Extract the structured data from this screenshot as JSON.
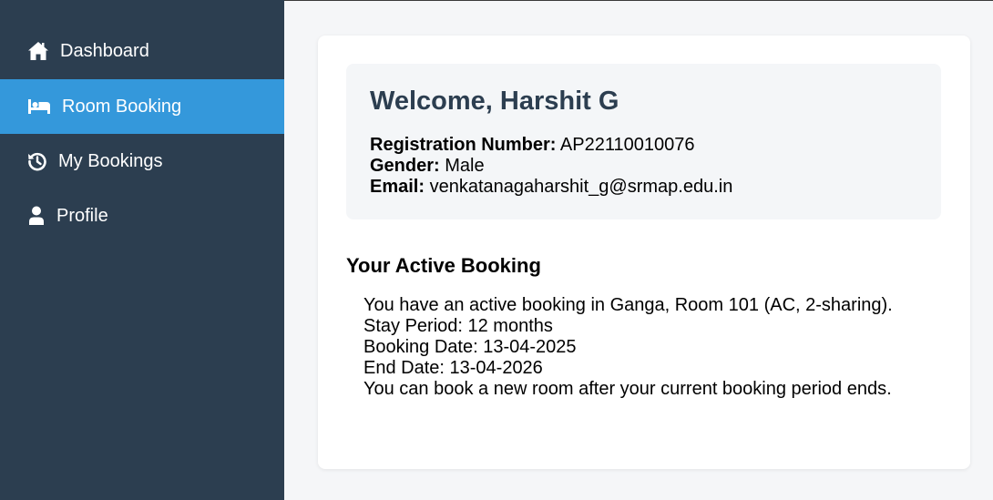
{
  "sidebar": {
    "items": [
      {
        "label": "Dashboard",
        "icon": "home-icon",
        "active": false
      },
      {
        "label": "Room Booking",
        "icon": "bed-icon",
        "active": true
      },
      {
        "label": "My Bookings",
        "icon": "history-icon",
        "active": false
      },
      {
        "label": "Profile",
        "icon": "user-icon",
        "active": false
      }
    ]
  },
  "welcome": {
    "title": "Welcome, Harshit G",
    "registration_label": "Registration Number:",
    "registration_value": "AP22110010076",
    "gender_label": "Gender:",
    "gender_value": "Male",
    "email_label": "Email:",
    "email_value": "venkatanagaharshit_g@srmap.edu.in"
  },
  "active_booking": {
    "title": "Your Active Booking",
    "message": "You have an active booking in Ganga, Room 101 (AC, 2-sharing).",
    "stay_period": "Stay Period: 12 months",
    "booking_date": "Booking Date: 13-04-2025",
    "end_date": "End Date: 13-04-2026",
    "note": "You can book a new room after your current booking period ends."
  },
  "colors": {
    "sidebar_bg": "#2c3e50",
    "active_item": "#3498db",
    "page_bg": "#f5f6f8",
    "title_color": "#2c3e50"
  }
}
